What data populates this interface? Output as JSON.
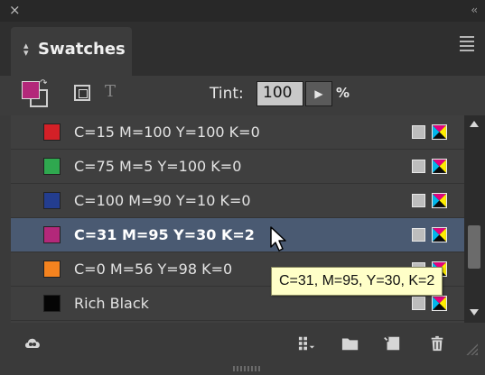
{
  "titlebar": {
    "close_glyph": "×",
    "collapse_glyph": "‹‹"
  },
  "panel": {
    "tab_title": "Swatches",
    "menu_icon": "hamburger-icon"
  },
  "toolbar": {
    "fill_color": "#b3287a",
    "tint_label": "Tint:",
    "tint_value": "100",
    "tint_button_glyph": "▶",
    "tint_unit": "%",
    "text_format_glyph": "T"
  },
  "swatches": [
    {
      "name": "C=15 M=100 Y=100 K=0",
      "color": "#d42027",
      "selected": false
    },
    {
      "name": "C=75 M=5 Y=100 K=0",
      "color": "#2fa84f",
      "selected": false
    },
    {
      "name": "C=100 M=90 Y=10 K=0",
      "color": "#233d8f",
      "selected": false
    },
    {
      "name": "C=31 M=95 Y=30 K=2",
      "color": "#b3287a",
      "selected": true
    },
    {
      "name": "C=0 M=56 Y=98 K=0",
      "color": "#f4831f",
      "selected": false
    },
    {
      "name": "Rich Black",
      "color": "#050505",
      "selected": false
    }
  ],
  "tooltip": {
    "text": "C=31, M=95, Y=30, K=2"
  },
  "bottom_icons": [
    "creative-cloud-icon",
    "swatch-view-icon",
    "new-group-folder-icon",
    "new-swatch-icon",
    "trash-icon"
  ]
}
